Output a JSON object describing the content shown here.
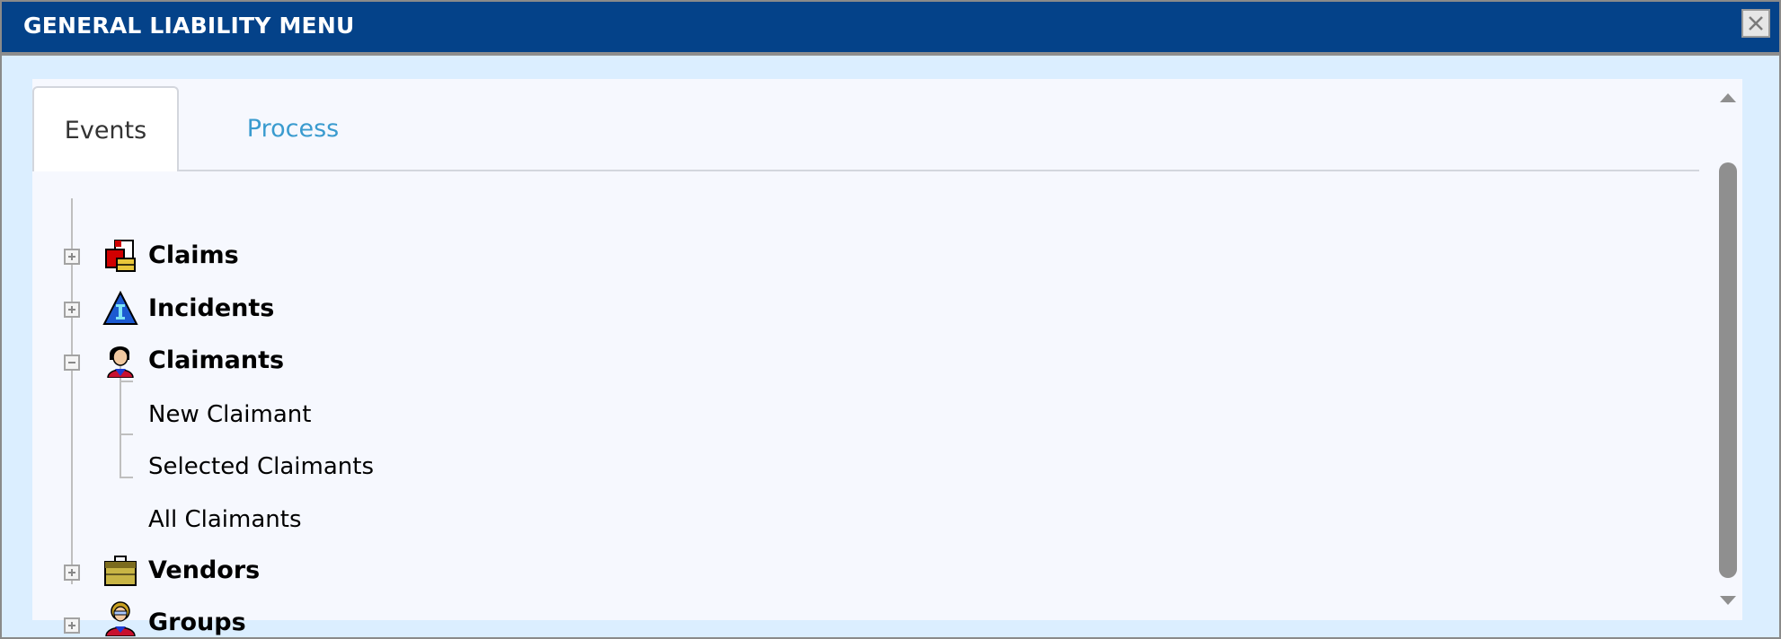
{
  "window": {
    "title": "GENERAL LIABILITY MENU",
    "close_icon": "close-icon"
  },
  "tabs": [
    {
      "label": "Events",
      "active": true
    },
    {
      "label": "Process",
      "active": false
    }
  ],
  "tree": {
    "nodes": [
      {
        "label": "Claims",
        "icon": "claims-icon",
        "expanded": false
      },
      {
        "label": "Incidents",
        "icon": "incidents-icon",
        "expanded": false
      },
      {
        "label": "Claimants",
        "icon": "claimants-icon",
        "expanded": true,
        "children": [
          {
            "label": "New Claimant"
          },
          {
            "label": "Selected Claimants"
          },
          {
            "label": "All Claimants"
          }
        ]
      },
      {
        "label": "Vendors",
        "icon": "vendors-icon",
        "expanded": false
      },
      {
        "label": "Groups",
        "icon": "groups-icon",
        "expanded": false
      }
    ]
  },
  "colors": {
    "titlebar": "#044289",
    "window_bg": "#dbeeff",
    "panel_bg": "#f6f8fe",
    "active_tab_text": "#333333",
    "inactive_tab_text": "#3a9bcf"
  }
}
